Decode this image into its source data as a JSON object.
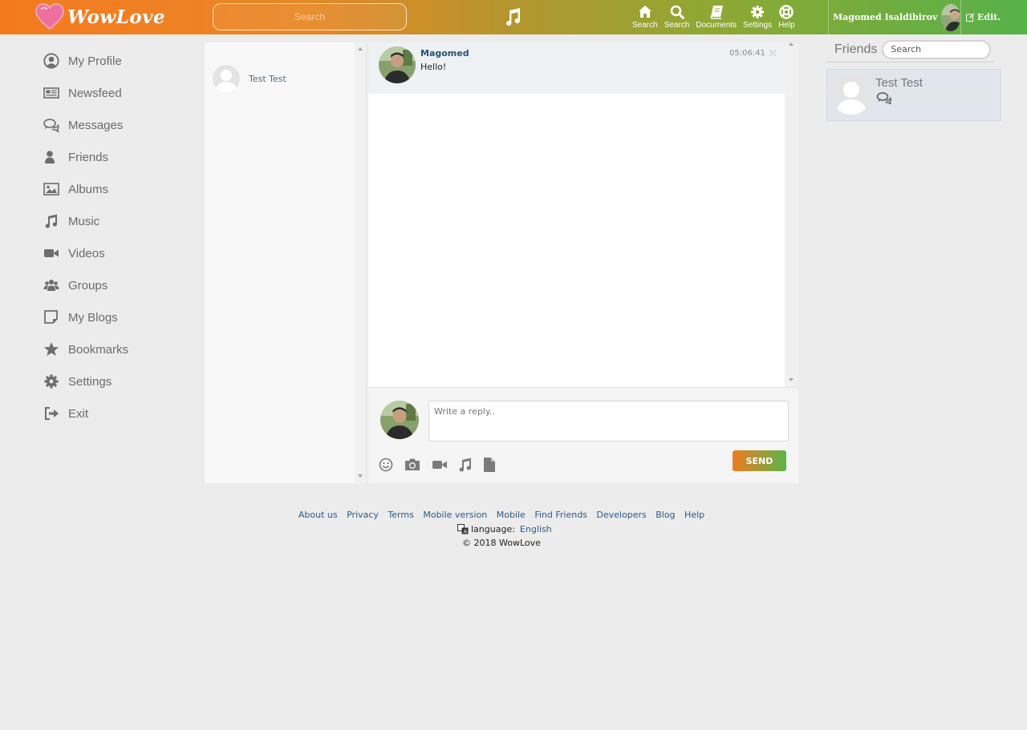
{
  "brand": {
    "name": "WowLove",
    "accent": "#f47a20",
    "accent2": "#57b14a"
  },
  "header": {
    "search_placeholder": "Search",
    "nav": [
      {
        "label": "Search",
        "icon": "home-icon"
      },
      {
        "label": "Search",
        "icon": "search-icon"
      },
      {
        "label": "Documents",
        "icon": "book-icon"
      },
      {
        "label": "Settings",
        "icon": "gear-icon"
      },
      {
        "label": "Help",
        "icon": "lifebuoy-icon"
      }
    ],
    "user_name": "Magomed Isaldibirov",
    "edit_label": "Edit."
  },
  "sidebar": {
    "items": [
      {
        "label": "My Profile",
        "icon": "user-circle-icon"
      },
      {
        "label": "Newsfeed",
        "icon": "newspaper-icon"
      },
      {
        "label": "Messages",
        "icon": "chat-bubbles-icon"
      },
      {
        "label": "Friends",
        "icon": "person-icon"
      },
      {
        "label": "Albums",
        "icon": "image-icon"
      },
      {
        "label": "Music",
        "icon": "music-note-icon"
      },
      {
        "label": "Videos",
        "icon": "video-camera-icon"
      },
      {
        "label": "Groups",
        "icon": "group-icon"
      },
      {
        "label": "My Blogs",
        "icon": "note-icon"
      },
      {
        "label": "Bookmarks",
        "icon": "star-icon"
      },
      {
        "label": "Settings",
        "icon": "gear-icon"
      },
      {
        "label": "Exit",
        "icon": "sign-out-icon"
      }
    ]
  },
  "dialogs": {
    "items": [
      {
        "name": "Test Test"
      }
    ]
  },
  "chat": {
    "messages": [
      {
        "author": "Magomed",
        "text": "Hello!",
        "time": "05:06:41"
      }
    ],
    "reply_placeholder": "Write a reply..",
    "send_label": "SEND"
  },
  "friends": {
    "title": "Friends",
    "search_placeholder": "Search",
    "items": [
      {
        "name": "Test Test"
      }
    ]
  },
  "footer": {
    "links": [
      "About us",
      "Privacy",
      "Terms",
      "Mobile version",
      "Mobile",
      "Find Friends",
      "Developers",
      "Blog",
      "Help"
    ],
    "language_label": "language:",
    "language_value": "English",
    "copyright": "© 2018 WowLove"
  }
}
